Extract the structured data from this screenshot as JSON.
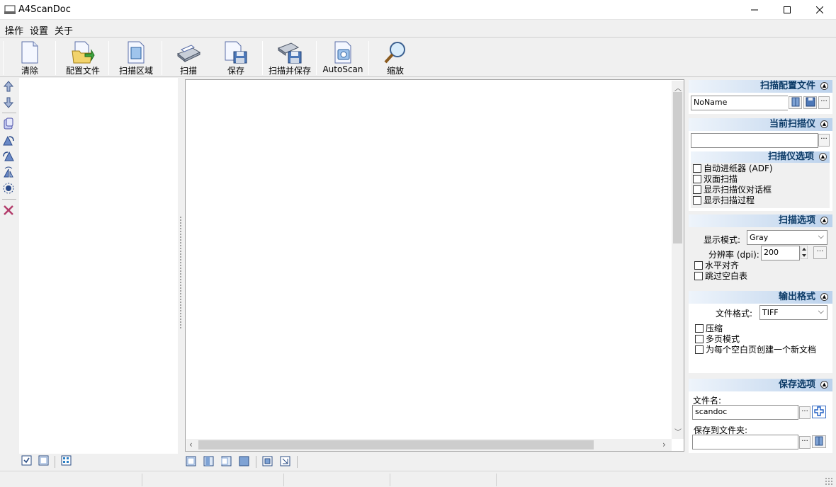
{
  "window": {
    "title": "A4ScanDoc",
    "minimize": "—",
    "maximize": "☐",
    "close": "✕"
  },
  "menu": [
    "操作",
    "设置",
    "关于"
  ],
  "toolbar": {
    "clear": "清除",
    "profile": "配置文件",
    "scan_area": "扫描区域",
    "scan": "扫描",
    "save": "保存",
    "scan_save": "扫描并保存",
    "autoscan": "AutoScan",
    "zoom": "缩放"
  },
  "right": {
    "profile_section": "扫描配置文件",
    "profile_value": "NoName",
    "scanner_section": "当前扫描仪",
    "scanner_value": "",
    "scanner_options": "扫描仪选项",
    "opt_adf": "自动进纸器 (ADF)",
    "opt_duplex": "双面扫描",
    "opt_dialog": "显示扫描仪对话框",
    "opt_progress": "显示扫描过程",
    "scan_options": "扫描选项",
    "display_mode_label": "显示模式:",
    "display_mode_value": "Gray",
    "resolution_label": "分辨率 (dpi):",
    "resolution_value": "200",
    "opt_h_align": "水平对齐",
    "opt_skip_blank": "跳过空白表",
    "output_format": "输出格式",
    "file_format_label": "文件格式:",
    "file_format_value": "TIFF",
    "opt_compress": "压缩",
    "opt_multipage": "多页模式",
    "opt_new_doc": "为每个空白页创建一个新文档",
    "save_options": "保存选项",
    "filename_label": "文件名:",
    "filename_value": "scandoc",
    "folder_label": "保存到文件夹:",
    "folder_value": ""
  },
  "colors": {
    "accent_header": "#bcd2ec",
    "header_text": "#0b3a66"
  }
}
